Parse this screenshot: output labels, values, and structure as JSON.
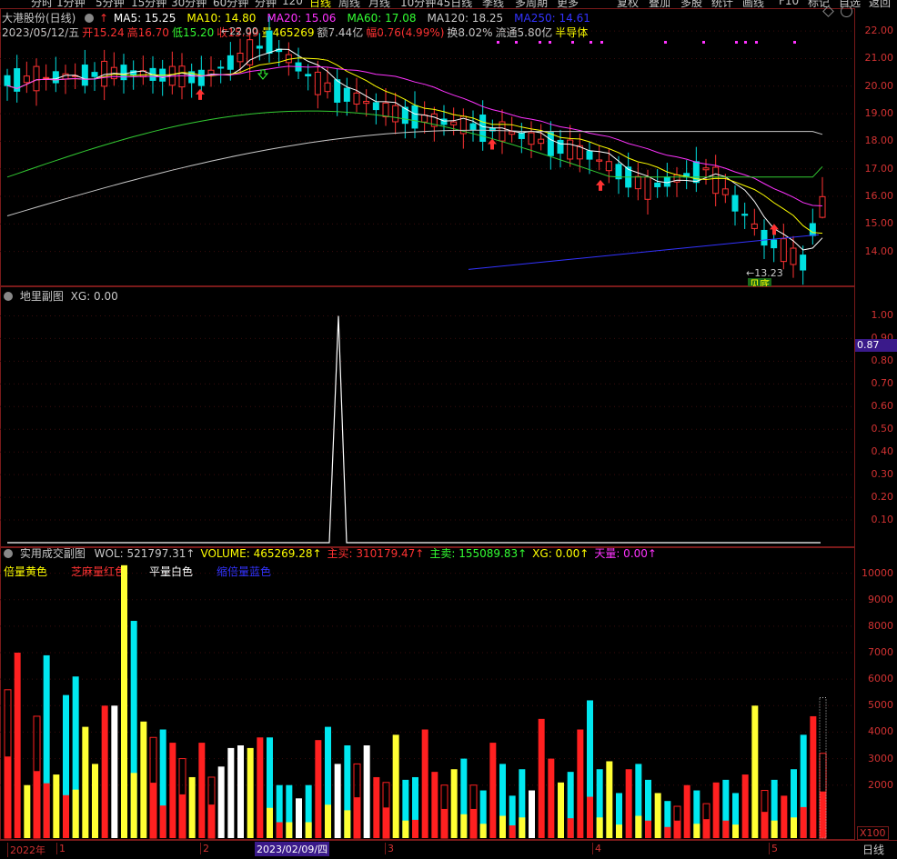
{
  "toolbar": {
    "left_items": [
      "分时",
      "1分钟",
      "5分钟",
      "15分钟",
      "30分钟",
      "60分钟",
      "分钟",
      "120",
      "日线",
      "周线",
      "月线",
      "10分钟",
      "45日线",
      "季线",
      "多周期",
      "更多"
    ],
    "right_items": [
      "复权",
      "叠加",
      "多股",
      "统计",
      "画线",
      "F10",
      "标记",
      "自选",
      "返回"
    ],
    "active": "日线"
  },
  "main": {
    "stock_name": "大港股份(日线)",
    "ma": [
      {
        "label": "MA5: 15.25",
        "color": "#ffffff"
      },
      {
        "label": "MA10: 14.80",
        "color": "#ffff00"
      },
      {
        "label": "MA20: 15.06",
        "color": "#ff33ff"
      },
      {
        "label": "MA60: 17.08",
        "color": "#33ff33"
      },
      {
        "label": "MA120: 18.25",
        "color": "#c8c8c8"
      },
      {
        "label": "MA250: 14.61",
        "color": "#3333ff"
      }
    ],
    "info": [
      {
        "label": "2023/05/12/五",
        "color": "#c8c8c8"
      },
      {
        "label": "开15.24",
        "color": "#ff3232"
      },
      {
        "label": "高16.70",
        "color": "#ff3232"
      },
      {
        "label": "低15.20",
        "color": "#33ff33"
      },
      {
        "label": "收15.99",
        "color": "#ff3232"
      },
      {
        "label": "量465269",
        "color": "#ffff00"
      },
      {
        "label": "额7.44亿",
        "color": "#c8c8c8"
      },
      {
        "label": "幅0.76(4.99%)",
        "color": "#ff3232"
      },
      {
        "label": "换8.02%",
        "color": "#c8c8c8"
      },
      {
        "label": "流通5.80亿",
        "color": "#c8c8c8"
      },
      {
        "label": "半导体",
        "color": "#ffff00"
      }
    ],
    "yaxis": [
      "22.00",
      "21.00",
      "20.00",
      "19.00",
      "18.00",
      "17.00",
      "16.00",
      "15.00",
      "14.00"
    ],
    "high_marker": "22.00",
    "low_marker": "13.23",
    "low_tag": "见底",
    "chart_data": {
      "type": "candlestick",
      "ylim": [
        13.0,
        22.5
      ],
      "ma_last": {
        "MA5": 15.25,
        "MA10": 14.8,
        "MA20": 15.06,
        "MA60": 17.08,
        "MA120": 18.25,
        "MA250": 14.61
      }
    }
  },
  "sub1": {
    "title": "地里副图",
    "value": "XG: 0.00",
    "yaxis": [
      "1.00",
      "0.90",
      "0.80",
      "0.70",
      "0.60",
      "0.50",
      "0.40",
      "0.30",
      "0.20",
      "0.10"
    ],
    "cursor_value": "0.87",
    "chart_data": {
      "type": "line",
      "ylim": [
        0,
        1.05
      ],
      "spike_value": 1.0
    }
  },
  "sub2": {
    "title": "实用成交副图",
    "values": [
      {
        "label": "WOL: 521797.31",
        "color": "#c8c8c8"
      },
      {
        "label": "VOLUME: 465269.28",
        "color": "#ffff00"
      },
      {
        "label": "主买: 310179.47",
        "color": "#ff3232"
      },
      {
        "label": "主卖: 155089.83",
        "color": "#33ff33"
      },
      {
        "label": "XG: 0.00",
        "color": "#ffff00"
      },
      {
        "label": "天量: 0.00",
        "color": "#ff33ff"
      }
    ],
    "legend": [
      {
        "label": "倍量黄色",
        "color": "#ffff00"
      },
      {
        "label": "芝麻量红色",
        "color": "#ff3232"
      },
      {
        "label": "平量白色",
        "color": "#ffffff"
      },
      {
        "label": "缩倍量蓝色",
        "color": "#3333ff"
      }
    ],
    "yaxis": [
      "10000",
      "9000",
      "8000",
      "7000",
      "6000",
      "5000",
      "4000",
      "3000",
      "2000"
    ],
    "multiplier": "X100",
    "chart_data": {
      "type": "bar",
      "ylim": [
        0,
        10500
      ],
      "values": [
        5600,
        7000,
        2000,
        4600,
        6900,
        2400,
        5400,
        6100,
        4200,
        2800,
        5000,
        5000,
        10300,
        8200,
        4400,
        3800,
        4100,
        3600,
        3000,
        2300,
        3600,
        2300,
        2700,
        3400,
        3500,
        3400,
        3800,
        3800,
        2000,
        2000,
        1500,
        2000,
        3700,
        4200,
        2800,
        3500,
        2800,
        3500,
        2300,
        2100,
        3900,
        2200,
        2300,
        4100,
        2500,
        2000,
        2600,
        3000,
        2000,
        1800,
        3600,
        2800,
        1600,
        2600,
        1800,
        4500,
        3000,
        2100,
        2500,
        4100,
        5200,
        2600,
        2900,
        1700,
        2600,
        2800,
        2200,
        1700,
        1400,
        1200,
        2000,
        1800,
        1300,
        2100,
        2200,
        1700,
        2400,
        5000,
        1800,
        2200,
        1600,
        2600,
        3900,
        4600,
        3200
      ],
      "colors": [
        "r",
        "r",
        "y",
        "r",
        "c",
        "y",
        "c",
        "c",
        "y",
        "y",
        "r",
        "w",
        "y",
        "c",
        "y",
        "r",
        "c",
        "r",
        "r",
        "y",
        "r",
        "r",
        "w",
        "w",
        "w",
        "y",
        "r",
        "c",
        "c",
        "c",
        "w",
        "c",
        "r",
        "c",
        "w",
        "c",
        "r",
        "w",
        "r",
        "r",
        "y",
        "c",
        "c",
        "r",
        "r",
        "r",
        "y",
        "c",
        "r",
        "c",
        "r",
        "c",
        "c",
        "c",
        "w",
        "r",
        "r",
        "y",
        "c",
        "r",
        "c",
        "c",
        "y",
        "c",
        "r",
        "c",
        "c",
        "y",
        "c",
        "r",
        "r",
        "c",
        "r",
        "r",
        "c",
        "c",
        "r",
        "y",
        "r",
        "c",
        "r",
        "c",
        "c",
        "r",
        "r"
      ]
    }
  },
  "xaxis": {
    "labels": [
      {
        "label": "2022年",
        "pos": 8
      },
      {
        "label": "1",
        "pos": 62
      },
      {
        "label": "2",
        "pos": 220
      },
      {
        "label": "3",
        "pos": 423
      },
      {
        "label": "4",
        "pos": 651
      },
      {
        "label": "5",
        "pos": 845
      }
    ],
    "cursor_date": "2023/02/09/四",
    "period": "日线"
  }
}
